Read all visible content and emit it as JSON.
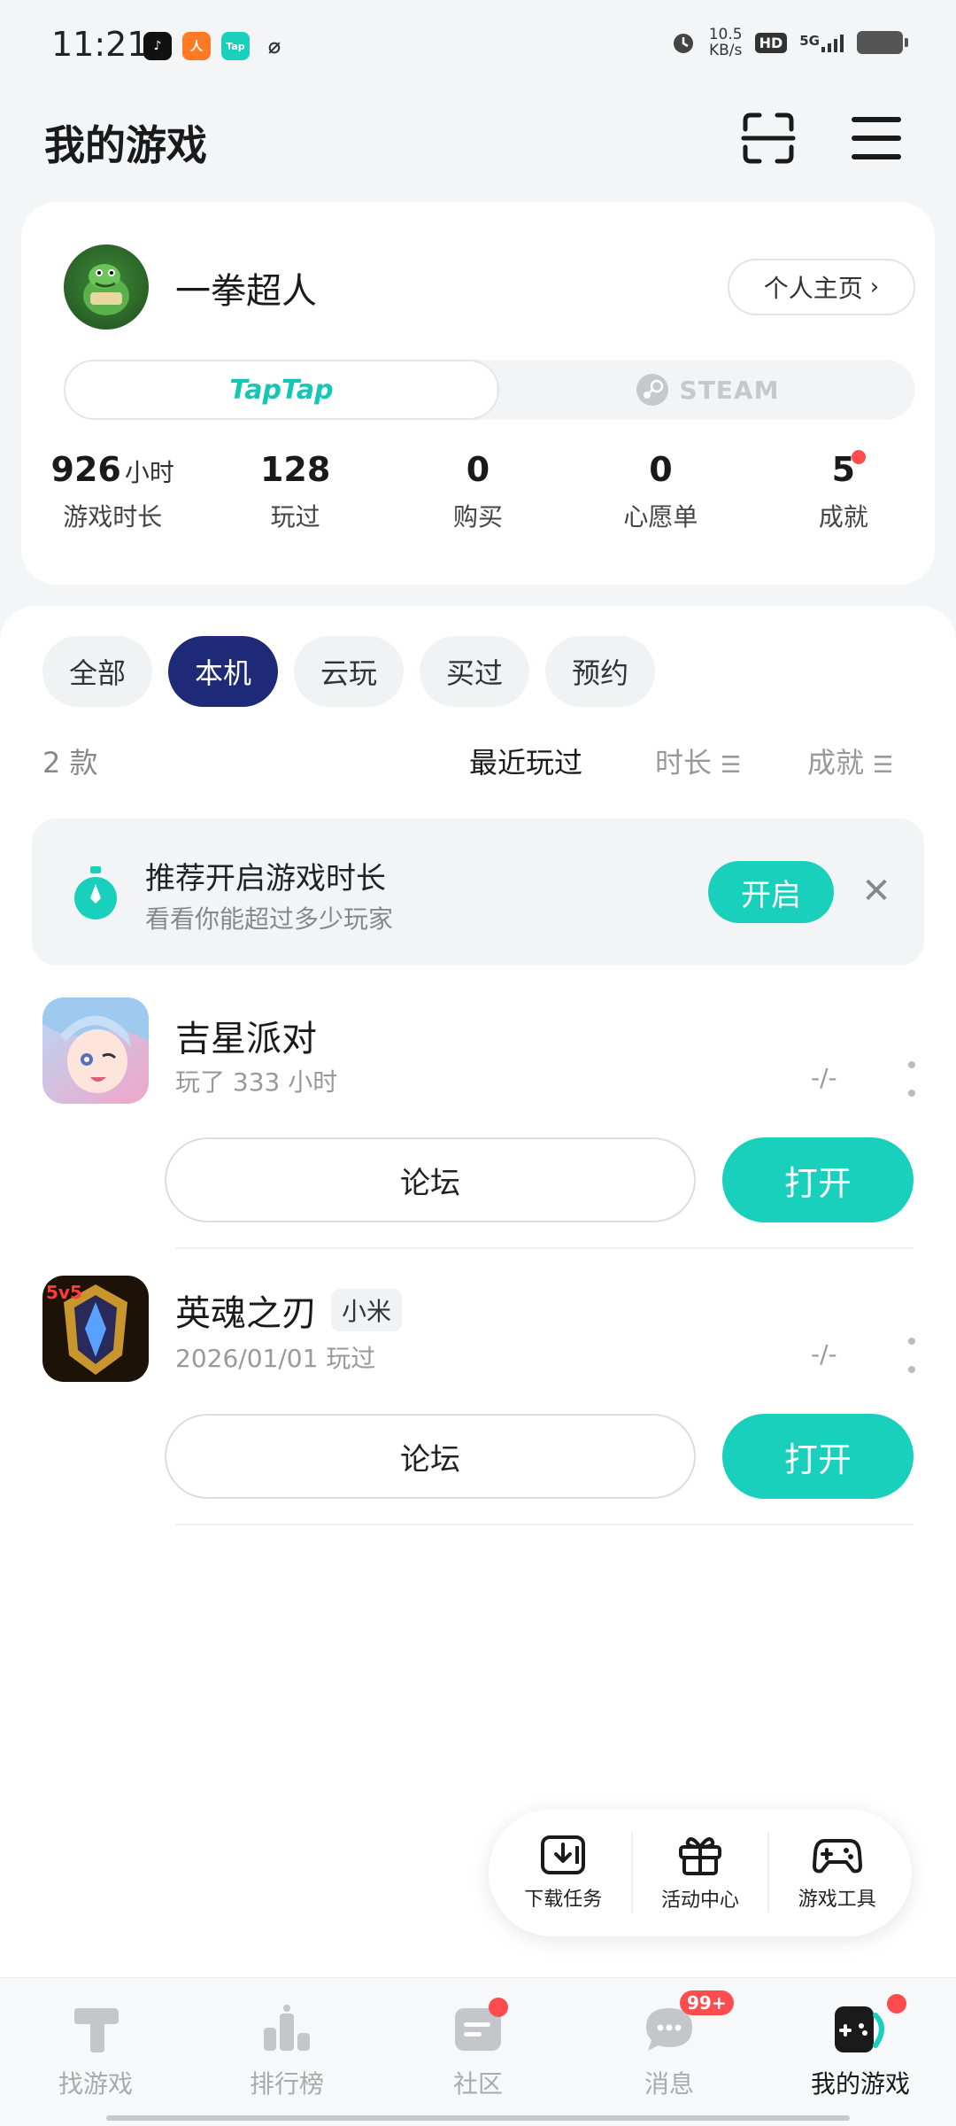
{
  "status_bar": {
    "time": "11:21",
    "net_speed_value": "10.5",
    "net_speed_unit": "KB/s",
    "hd": "HD",
    "network": "5G"
  },
  "header": {
    "title": "我的游戏"
  },
  "profile": {
    "username": "一拳超人",
    "home_link": "个人主页",
    "platforms": {
      "taptap": "TapTap",
      "steam": "STEAM"
    },
    "stats": [
      {
        "value": "926",
        "unit": "小时",
        "label": "游戏时长"
      },
      {
        "value": "128",
        "unit": "",
        "label": "玩过"
      },
      {
        "value": "0",
        "unit": "",
        "label": "购买"
      },
      {
        "value": "0",
        "unit": "",
        "label": "心愿单"
      },
      {
        "value": "5",
        "unit": "",
        "label": "成就"
      }
    ]
  },
  "filters": [
    "全部",
    "本机",
    "云玩",
    "买过",
    "预约"
  ],
  "filter_active": "本机",
  "list": {
    "count": "2 款",
    "sort_recent": "最近玩过",
    "sort_duration": "时长",
    "sort_achievement": "成就"
  },
  "tip": {
    "title": "推荐开启游戏时长",
    "subtitle": "看看你能超过多少玩家",
    "button": "开启"
  },
  "games": [
    {
      "title": "吉星派对",
      "tag": "",
      "subtitle": "玩了 333 小时",
      "rating": "-/-",
      "forum": "论坛",
      "open": "打开"
    },
    {
      "title": "英魂之刃",
      "tag": "小米",
      "subtitle": "2026/01/01 玩过",
      "rating": "-/-",
      "forum": "论坛",
      "open": "打开"
    }
  ],
  "game2_icon_text": "5v5",
  "tools": [
    {
      "label": "下载任务",
      "icon": "download-icon"
    },
    {
      "label": "活动中心",
      "icon": "gift-icon"
    },
    {
      "label": "游戏工具",
      "icon": "gamepad-icon"
    }
  ],
  "nav": [
    {
      "label": "找游戏",
      "icon": "find-game-icon"
    },
    {
      "label": "排行榜",
      "icon": "ranking-icon"
    },
    {
      "label": "社区",
      "icon": "community-icon"
    },
    {
      "label": "消息",
      "icon": "message-icon",
      "badge": "99+"
    },
    {
      "label": "我的游戏",
      "icon": "my-games-icon"
    }
  ],
  "colors": {
    "accent": "#18d0bb",
    "active_chip": "#1e2a78",
    "badge": "#ff4d4f"
  }
}
